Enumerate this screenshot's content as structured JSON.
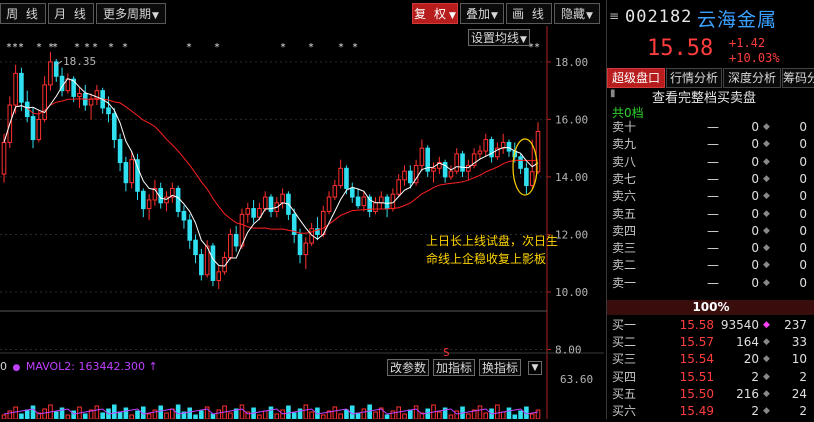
{
  "toolbar": {
    "left": [
      "周 线",
      "月 线",
      "更多周期"
    ],
    "right": [
      "复 权",
      "叠加",
      "画 线",
      "隐藏"
    ],
    "active": "复 权"
  },
  "chart": {
    "ma_button": "设置均线",
    "max_label": "18.35",
    "ytick_labels": [
      "18.00",
      "16.00",
      "14.00",
      "12.00",
      "10.00",
      "8.00"
    ],
    "ytick_values": [
      18,
      16,
      14,
      12,
      10,
      8
    ],
    "vol_label": "63.60",
    "annotation_line1": "上日长上线试盘，次日生",
    "annotation_line2": "命线上企稳收复上影板",
    "mavol_label": "MAVOL2: 163442.300",
    "vol_prefix": "0",
    "vol_buttons": [
      "改参数",
      "加指标",
      "换指标"
    ],
    "s_marker": "S",
    "colors": {
      "up": "#ff3030",
      "down": "#30e0f0",
      "ma5": "#ffffff",
      "ma20": "#ff2020",
      "annotation": "#ffd400",
      "mavol": "#c040ff"
    }
  },
  "chart_data": {
    "type": "candlestick",
    "ylim": [
      7.6,
      18.9
    ],
    "candles": [
      [
        14.1,
        15.5,
        13.8,
        15.2
      ],
      [
        15.2,
        16.8,
        15.0,
        16.5
      ],
      [
        16.5,
        17.9,
        16.2,
        17.6
      ],
      [
        17.6,
        17.8,
        16.3,
        16.6
      ],
      [
        16.6,
        17.0,
        15.9,
        16.1
      ],
      [
        16.1,
        16.4,
        15.0,
        15.3
      ],
      [
        15.3,
        16.3,
        15.2,
        16.0
      ],
      [
        16.0,
        17.5,
        15.9,
        17.2
      ],
      [
        17.2,
        18.35,
        17.0,
        18.0
      ],
      [
        18.0,
        18.1,
        17.3,
        17.5
      ],
      [
        17.5,
        17.8,
        16.8,
        17.0
      ],
      [
        17.0,
        17.6,
        16.9,
        17.4
      ],
      [
        17.4,
        17.5,
        16.6,
        16.8
      ],
      [
        16.8,
        17.1,
        16.4,
        16.9
      ],
      [
        16.9,
        17.2,
        16.3,
        16.5
      ],
      [
        16.5,
        16.9,
        16.0,
        16.7
      ],
      [
        16.7,
        17.2,
        16.5,
        17.0
      ],
      [
        17.0,
        17.1,
        16.2,
        16.4
      ],
      [
        16.4,
        16.8,
        15.9,
        16.2
      ],
      [
        16.2,
        16.4,
        15.0,
        15.3
      ],
      [
        15.3,
        15.5,
        14.2,
        14.5
      ],
      [
        14.5,
        14.7,
        13.5,
        13.8
      ],
      [
        13.8,
        14.9,
        13.6,
        14.6
      ],
      [
        14.6,
        14.8,
        13.2,
        13.5
      ],
      [
        13.5,
        13.6,
        12.6,
        12.9
      ],
      [
        12.9,
        13.4,
        12.5,
        13.2
      ],
      [
        13.2,
        13.9,
        13.0,
        13.6
      ],
      [
        13.6,
        13.8,
        12.9,
        13.1
      ],
      [
        13.1,
        13.5,
        12.8,
        13.3
      ],
      [
        13.3,
        13.8,
        13.1,
        13.6
      ],
      [
        13.6,
        13.7,
        12.6,
        12.8
      ],
      [
        12.8,
        13.0,
        12.2,
        12.5
      ],
      [
        12.5,
        12.7,
        11.5,
        11.8
      ],
      [
        11.8,
        12.0,
        11.0,
        11.3
      ],
      [
        11.3,
        11.5,
        10.4,
        10.6
      ],
      [
        10.6,
        11.8,
        10.5,
        11.6
      ],
      [
        11.6,
        11.7,
        10.2,
        10.4
      ],
      [
        10.4,
        10.9,
        10.1,
        10.7
      ],
      [
        10.7,
        11.4,
        10.6,
        11.2
      ],
      [
        11.2,
        12.2,
        11.1,
        12.0
      ],
      [
        12.0,
        12.3,
        11.4,
        11.6
      ],
      [
        11.6,
        12.9,
        11.5,
        12.7
      ],
      [
        12.7,
        13.1,
        12.4,
        12.9
      ],
      [
        12.9,
        13.2,
        12.4,
        12.6
      ],
      [
        12.6,
        13.1,
        12.5,
        12.9
      ],
      [
        12.9,
        13.5,
        12.8,
        13.3
      ],
      [
        13.3,
        13.4,
        12.6,
        12.8
      ],
      [
        12.8,
        13.3,
        12.6,
        13.1
      ],
      [
        13.1,
        13.6,
        12.9,
        13.4
      ],
      [
        13.4,
        13.5,
        12.5,
        12.7
      ],
      [
        12.7,
        12.9,
        11.7,
        12.0
      ],
      [
        12.0,
        12.2,
        11.0,
        11.3
      ],
      [
        11.3,
        11.9,
        10.8,
        11.7
      ],
      [
        11.7,
        12.4,
        11.6,
        12.2
      ],
      [
        12.2,
        12.6,
        11.8,
        12.0
      ],
      [
        12.0,
        13.0,
        11.9,
        12.8
      ],
      [
        12.8,
        13.5,
        12.7,
        13.3
      ],
      [
        13.3,
        13.9,
        13.2,
        13.7
      ],
      [
        13.7,
        14.6,
        13.6,
        14.3
      ],
      [
        14.3,
        14.4,
        13.4,
        13.6
      ],
      [
        13.6,
        13.8,
        13.1,
        13.3
      ],
      [
        13.3,
        13.6,
        12.9,
        13.0
      ],
      [
        13.0,
        13.5,
        12.8,
        13.3
      ],
      [
        13.3,
        13.4,
        12.6,
        12.8
      ],
      [
        12.8,
        13.3,
        12.7,
        13.1
      ],
      [
        13.1,
        13.5,
        12.9,
        13.3
      ],
      [
        13.3,
        13.4,
        12.6,
        12.9
      ],
      [
        12.9,
        13.6,
        12.8,
        13.4
      ],
      [
        13.4,
        14.1,
        13.3,
        13.9
      ],
      [
        13.9,
        14.4,
        13.7,
        14.2
      ],
      [
        14.2,
        14.4,
        13.6,
        13.8
      ],
      [
        13.8,
        14.6,
        13.7,
        14.4
      ],
      [
        14.4,
        15.3,
        14.2,
        15.0
      ],
      [
        15.0,
        15.1,
        14.0,
        14.2
      ],
      [
        14.2,
        14.5,
        13.8,
        14.3
      ],
      [
        14.3,
        14.7,
        14.1,
        14.5
      ],
      [
        14.5,
        14.6,
        13.8,
        14.0
      ],
      [
        14.0,
        14.4,
        13.9,
        14.2
      ],
      [
        14.2,
        15.0,
        14.1,
        14.8
      ],
      [
        14.8,
        14.9,
        14.0,
        14.2
      ],
      [
        14.2,
        14.6,
        13.9,
        14.4
      ],
      [
        14.4,
        15.0,
        14.3,
        14.8
      ],
      [
        14.8,
        15.1,
        14.6,
        14.9
      ],
      [
        14.9,
        15.5,
        14.7,
        15.3
      ],
      [
        15.3,
        15.4,
        14.5,
        14.7
      ],
      [
        14.7,
        15.2,
        14.6,
        15.0
      ],
      [
        15.0,
        15.5,
        14.8,
        15.2
      ],
      [
        15.2,
        15.3,
        14.7,
        14.9
      ],
      [
        14.9,
        15.2,
        14.5,
        14.7
      ],
      [
        14.7,
        14.8,
        14.1,
        14.3
      ],
      [
        14.3,
        14.5,
        13.4,
        13.7
      ],
      [
        13.7,
        15.3,
        13.6,
        14.18
      ],
      [
        14.18,
        15.9,
        14.1,
        15.58
      ]
    ]
  },
  "stock": {
    "code": "002182",
    "name": "云海金属",
    "price": "15.58",
    "change": "+1.42",
    "change_pct": "+10.03%"
  },
  "panel": {
    "tabs": [
      "超级盘口",
      "行情分析",
      "深度分析",
      "筹码分"
    ],
    "active_tab": "超级盘口",
    "link": "查看完整档买卖盘",
    "total": "共0档",
    "sells": [
      {
        "level": "卖十",
        "price": "—",
        "vol": "0",
        "cnt": "0"
      },
      {
        "level": "卖九",
        "price": "—",
        "vol": "0",
        "cnt": "0"
      },
      {
        "level": "卖八",
        "price": "—",
        "vol": "0",
        "cnt": "0"
      },
      {
        "level": "卖七",
        "price": "—",
        "vol": "0",
        "cnt": "0"
      },
      {
        "level": "卖六",
        "price": "—",
        "vol": "0",
        "cnt": "0"
      },
      {
        "level": "卖五",
        "price": "—",
        "vol": "0",
        "cnt": "0"
      },
      {
        "level": "卖四",
        "price": "—",
        "vol": "0",
        "cnt": "0"
      },
      {
        "level": "卖三",
        "price": "—",
        "vol": "0",
        "cnt": "0"
      },
      {
        "level": "卖二",
        "price": "—",
        "vol": "0",
        "cnt": "0"
      },
      {
        "level": "卖一",
        "price": "—",
        "vol": "0",
        "cnt": "0"
      }
    ],
    "ratio": "100%",
    "buys": [
      {
        "level": "买一",
        "price": "15.58",
        "vol": "93540",
        "cnt": "237"
      },
      {
        "level": "买二",
        "price": "15.57",
        "vol": "164",
        "cnt": "33"
      },
      {
        "level": "买三",
        "price": "15.54",
        "vol": "20",
        "cnt": "10"
      },
      {
        "level": "买四",
        "price": "15.51",
        "vol": "2",
        "cnt": "2"
      },
      {
        "level": "买五",
        "price": "15.50",
        "vol": "216",
        "cnt": "24"
      },
      {
        "level": "买六",
        "price": "15.49",
        "vol": "2",
        "cnt": "2"
      }
    ]
  }
}
